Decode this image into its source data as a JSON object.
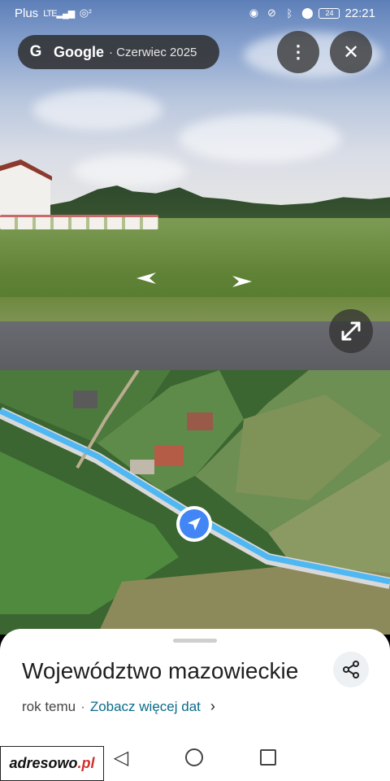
{
  "status_bar": {
    "carrier": "Plus",
    "network": "LTE",
    "hotspot": "²",
    "time": "22:21",
    "battery": "24",
    "icons": [
      "eye-icon",
      "mute-icon",
      "bluetooth-icon",
      "location-icon",
      "battery-icon"
    ]
  },
  "header": {
    "brand": "Google",
    "date": "· Czerwiec 2025",
    "more_label": "⋮",
    "close_label": "✕"
  },
  "street_view": {
    "arrow_left": "◀",
    "arrow_right": "▶",
    "expand_label": "⤡"
  },
  "place": {
    "title": "Województwo mazowieckie",
    "age": "rok temu",
    "separator": "·",
    "more_dates": "Zobacz więcej dat",
    "chevron": "›"
  },
  "watermark": {
    "name": "adresowo",
    "tld": ".pl"
  },
  "colors": {
    "route": "#4fb7f2",
    "locator": "#4285f4",
    "link": "#0b6b8a"
  }
}
